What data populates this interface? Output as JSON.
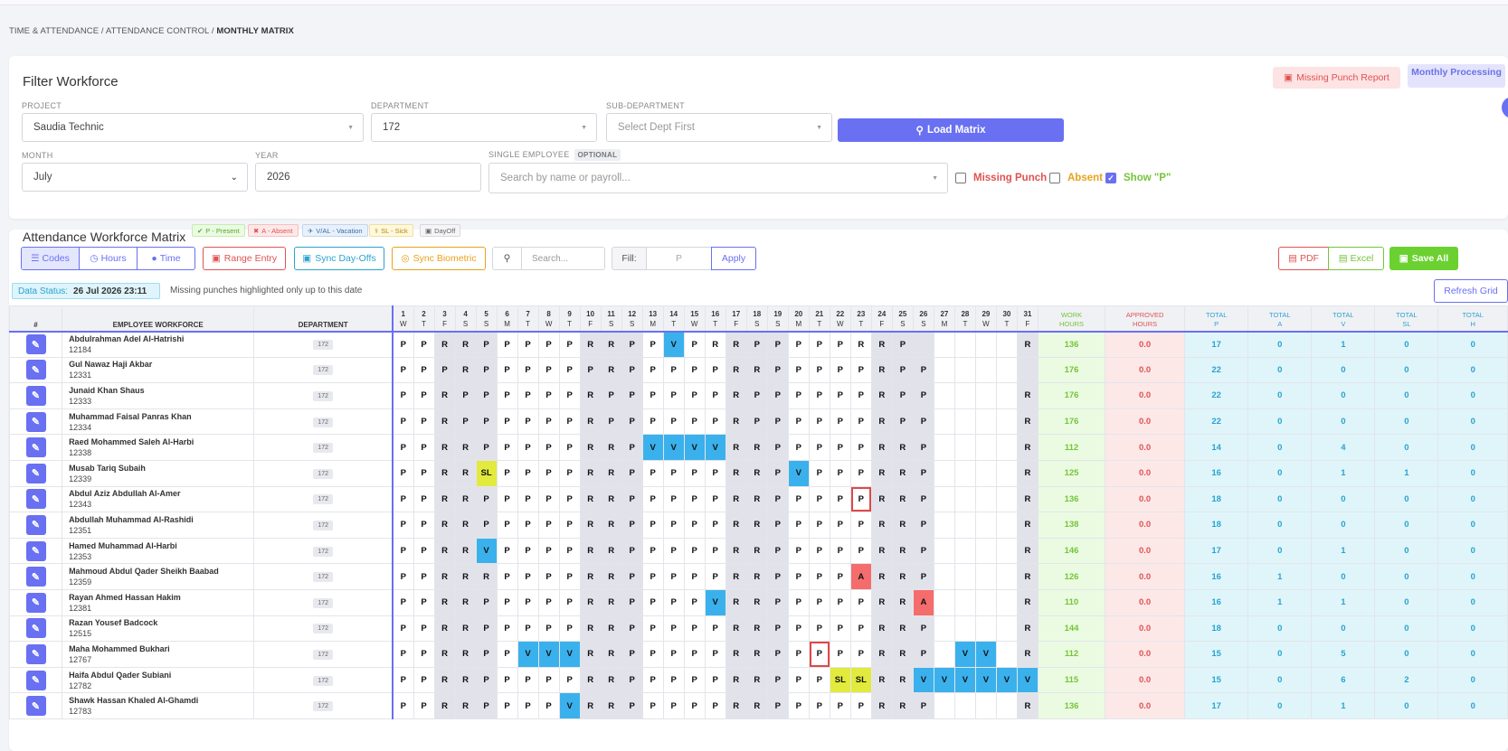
{
  "breadcrumb": {
    "path": "TIME & ATTENDANCE / ATTENDANCE CONTROL / ",
    "current": "MONTHLY MATRIX"
  },
  "filter": {
    "title": "Filter Workforce",
    "missing_punch_report": "Missing Punch Report",
    "monthly_processing": "Monthly Processing",
    "project_label": "PROJECT",
    "project_value": "Saudia Technic",
    "department_label": "DEPARTMENT",
    "department_value": "172",
    "subdept_label": "SUB-DEPARTMENT",
    "subdept_value": "Select Dept First",
    "load_button": "Load Matrix",
    "month_label": "MONTH",
    "month_value": "July",
    "year_label": "YEAR",
    "year_value": "2026",
    "employee_label": "SINGLE EMPLOYEE",
    "optional": "OPTIONAL",
    "employee_placeholder": "Search by name or payroll...",
    "missing_punch": "Missing Punch",
    "absent": "Absent",
    "show_p": "Show \"P\""
  },
  "matrix": {
    "title": "Attendance Workforce Matrix",
    "legend": [
      "P - Present",
      "A - Absent",
      "V/AL - Vacation",
      "SL - Sick",
      "DayOff"
    ],
    "view_codes": "Codes",
    "view_hours": "Hours",
    "view_time": "Time",
    "range_entry": "Range Entry",
    "sync_dayoffs": "Sync Day-Offs",
    "sync_biometric": "Sync Biometric",
    "search_placeholder": "Search...",
    "fill_label": "Fill:",
    "fill_placeholder": "P",
    "apply": "Apply",
    "pdf": "PDF",
    "excel": "Excel",
    "save_all": "Save All",
    "data_status_label": "Data Status:",
    "data_status_value": "26 Jul 2026 23:11",
    "note": "Missing punches highlighted only up to this date",
    "refresh": "Refresh Grid",
    "col_no": "#",
    "col_emp": "EMPLOYEE WORKFORCE",
    "col_dept": "DEPARTMENT",
    "days": [
      "1",
      "2",
      "3",
      "4",
      "5",
      "6",
      "7",
      "8",
      "9",
      "10",
      "11",
      "12",
      "13",
      "14",
      "15",
      "16",
      "17",
      "18",
      "19",
      "20",
      "21",
      "22",
      "23",
      "24",
      "25",
      "26",
      "27",
      "28",
      "29",
      "30",
      "31"
    ],
    "weekdays": [
      "W",
      "T",
      "F",
      "S",
      "S",
      "M",
      "T",
      "W",
      "T",
      "F",
      "S",
      "S",
      "M",
      "T",
      "W",
      "T",
      "F",
      "S",
      "S",
      "M",
      "T",
      "W",
      "T",
      "F",
      "S",
      "S",
      "M",
      "T",
      "W",
      "T",
      "F"
    ],
    "totals_headers": [
      [
        "WORK",
        "HOURS"
      ],
      [
        "APPROVED",
        "HOURS"
      ],
      [
        "TOTAL",
        "P"
      ],
      [
        "TOTAL",
        "A"
      ],
      [
        "TOTAL",
        "V"
      ],
      [
        "TOTAL",
        "SL"
      ],
      [
        "TOTAL",
        "H"
      ]
    ],
    "colors": {
      "accent": "#6970f2",
      "vacation": "#3ab1ec",
      "sick": "#e2ea3d",
      "absent": "#f56c6c",
      "weekend": "#e1e2ea"
    },
    "rows": [
      {
        "name": "Abdulrahman Adel Al-Hatrishi",
        "payroll": "12184",
        "dept": "172",
        "days": "P P R R P P P P P R R P P V P R R P P P P P R R P - - - - - R",
        "wh": "136",
        "ap": "0.0",
        "tp": "17",
        "ta": "0",
        "tv": "1",
        "tsl": "0",
        "th": "0"
      },
      {
        "name": "Gul Nawaz Haji Akbar",
        "payroll": "12331",
        "dept": "172",
        "days": "P P P R P P P P P P R P P P P P R R P P P P P R P P - - - - -",
        "wh": "176",
        "ap": "0.0",
        "tp": "22",
        "ta": "0",
        "tv": "0",
        "tsl": "0",
        "th": "0"
      },
      {
        "name": "Junaid Khan Shaus",
        "payroll": "12333",
        "dept": "172",
        "days": "P P R P P P P P P R P P P P P P R P P P P P P R P P - - - - R",
        "wh": "176",
        "ap": "0.0",
        "tp": "22",
        "ta": "0",
        "tv": "0",
        "tsl": "0",
        "th": "0"
      },
      {
        "name": "Muhammad Faisal Panras Khan",
        "payroll": "12334",
        "dept": "172",
        "days": "P P R P P P P P P R P P P P P P R P P P P P P R P P - - - - R",
        "wh": "176",
        "ap": "0.0",
        "tp": "22",
        "ta": "0",
        "tv": "0",
        "tsl": "0",
        "th": "0"
      },
      {
        "name": "Raed Mohammed Saleh Al-Harbi",
        "payroll": "12338",
        "dept": "172",
        "days": "P P R R P P P P P R R P V V V V R R P P P P P R R P - - - - R",
        "wh": "112",
        "ap": "0.0",
        "tp": "14",
        "ta": "0",
        "tv": "4",
        "tsl": "0",
        "th": "0"
      },
      {
        "name": "Musab Tariq Subaih",
        "payroll": "12339",
        "dept": "172",
        "days": "P P R R SL P P P P R R P P P P P R R P V P P P R R P - - - - R",
        "wh": "125",
        "ap": "0.0",
        "tp": "16",
        "ta": "0",
        "tv": "1",
        "tsl": "1",
        "th": "0"
      },
      {
        "name": "Abdul Aziz Abdullah Al-Amer",
        "payroll": "12343",
        "dept": "172",
        "days": "P P R R P P P P P R R P P P P P R R P P P P P* R R P - - - - R",
        "wh": "136",
        "ap": "0.0",
        "tp": "18",
        "ta": "0",
        "tv": "0",
        "tsl": "0",
        "th": "0"
      },
      {
        "name": "Abdullah Muhammad Al-Rashidi",
        "payroll": "12351",
        "dept": "172",
        "days": "P P R R P P P P P R R P P P P P R R P P P P P R R P - - - - R",
        "wh": "138",
        "ap": "0.0",
        "tp": "18",
        "ta": "0",
        "tv": "0",
        "tsl": "0",
        "th": "0"
      },
      {
        "name": "Hamed Muhammad Al-Harbi",
        "payroll": "12353",
        "dept": "172",
        "days": "P P R R V P P P P R R P P P P P R R P P P P P R R P - - - - R",
        "wh": "146",
        "ap": "0.0",
        "tp": "17",
        "ta": "0",
        "tv": "1",
        "tsl": "0",
        "th": "0"
      },
      {
        "name": "Mahmoud Abdul Qader Sheikh Baabad",
        "payroll": "12359",
        "dept": "172",
        "days": "P P R R R P P P P R R P P P P P R R P P P P A R R P - - - - R",
        "wh": "126",
        "ap": "0.0",
        "tp": "16",
        "ta": "1",
        "tv": "0",
        "tsl": "0",
        "th": "0"
      },
      {
        "name": "Rayan Ahmed Hassan Hakim",
        "payroll": "12381",
        "dept": "172",
        "days": "P P R R P P P P P R R P P P P V R R P P P P P R R A - - - - R",
        "wh": "110",
        "ap": "0.0",
        "tp": "16",
        "ta": "1",
        "tv": "1",
        "tsl": "0",
        "th": "0"
      },
      {
        "name": "Razan Yousef Badcock",
        "payroll": "12515",
        "dept": "172",
        "days": "P P R R P P P P P R R P P P P P R R P P P P P R R P - - - - R",
        "wh": "144",
        "ap": "0.0",
        "tp": "18",
        "ta": "0",
        "tv": "0",
        "tsl": "0",
        "th": "0"
      },
      {
        "name": "Maha Mohammed Bukhari",
        "payroll": "12767",
        "dept": "172",
        "days": "P P R R P P V V V R R P P P P P R R P P P* P P R R P - V V - R",
        "wh": "112",
        "ap": "0.0",
        "tp": "15",
        "ta": "0",
        "tv": "5",
        "tsl": "0",
        "th": "0"
      },
      {
        "name": "Haifa Abdul Qader Subiani",
        "payroll": "12782",
        "dept": "172",
        "days": "P P R R P P P P P R R P P P P P R R P P P SL SL R R V V V V V V",
        "wh": "115",
        "ap": "0.0",
        "tp": "15",
        "ta": "0",
        "tv": "6",
        "tsl": "2",
        "th": "0"
      },
      {
        "name": "Shawk Hassan Khaled Al-Ghamdi",
        "payroll": "12783",
        "dept": "172",
        "days": "P P R R P P P P V R R P P P P P R R P P P P P R R P - - - - R",
        "wh": "136",
        "ap": "0.0",
        "tp": "17",
        "ta": "0",
        "tv": "1",
        "tsl": "0",
        "th": "0"
      }
    ]
  }
}
